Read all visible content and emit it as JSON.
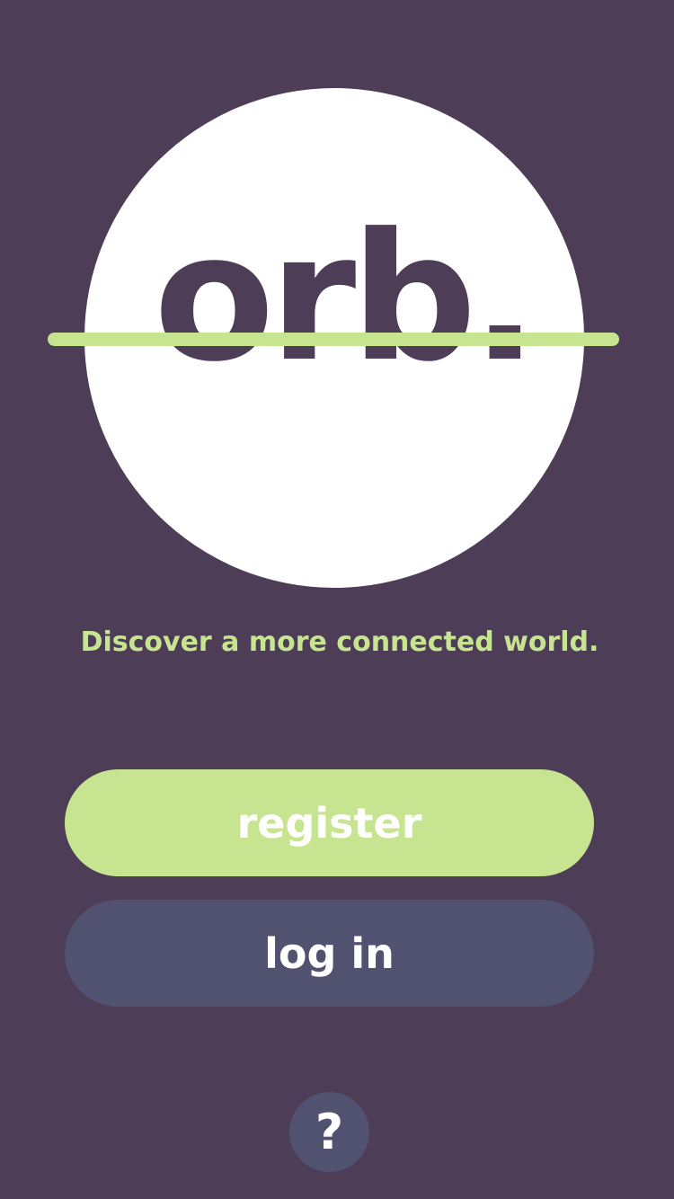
{
  "logo": {
    "text": "orb."
  },
  "tagline": "Discover a more connected world.",
  "actions": {
    "register_label": "register",
    "login_label": "log in",
    "help_label": "?"
  },
  "colors": {
    "background": "#4e3d56",
    "accent": "#c7e590",
    "secondary_button": "#51526f",
    "logo_circle": "#ffffff"
  }
}
